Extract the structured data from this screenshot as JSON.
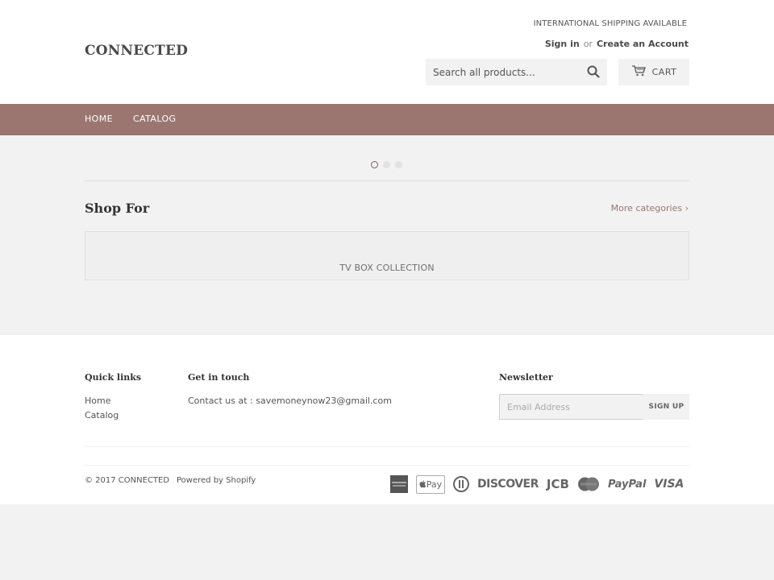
{
  "header": {
    "logo": "CONNECTED",
    "shipping_notice": "INTERNATIONAL SHIPPING AVAILABLE",
    "sign_in": "Sign in",
    "or": "or",
    "create_account": "Create an Account",
    "search_placeholder": "Search all products...",
    "search_icon": "search-icon",
    "cart_icon": "cart-icon",
    "cart_label": "CART"
  },
  "nav": {
    "items": [
      {
        "label": "HOME"
      },
      {
        "label": "CATALOG"
      }
    ]
  },
  "slideshow": {
    "slide_count": 3,
    "active_slide": 1
  },
  "main": {
    "section_title": "Shop For",
    "more_link": "More categories ›",
    "collections": [
      {
        "title": "TV BOX COLLECTION"
      }
    ]
  },
  "footer": {
    "quick_links": {
      "heading": "Quick links",
      "links": [
        "Home",
        "Catalog"
      ]
    },
    "contact": {
      "heading": "Get in touch",
      "text": "Contact us at : savemoneynow23@gmail.com"
    },
    "newsletter": {
      "heading": "Newsletter",
      "email_placeholder": "Email Address",
      "email_value": "",
      "button_label": "SIGN UP"
    },
    "copyright": "© 2017 CONNECTED",
    "powered_by": "Powered by Shopify",
    "payment_icons": [
      "american-express-icon",
      "apple-pay-icon",
      "diners-club-icon",
      "discover-icon",
      "jcb-icon",
      "master-card-icon",
      "paypal-icon",
      "visa-icon"
    ],
    "payment_labels": {
      "apple_pay": "Pay",
      "discover": "DISCOVER",
      "jcb": "JCB",
      "paypal": "PayPal",
      "visa": "VISA"
    }
  },
  "colors": {
    "nav_background": "#9b7670",
    "accent": "#9b7670",
    "page_background": "#f2f2f2"
  }
}
